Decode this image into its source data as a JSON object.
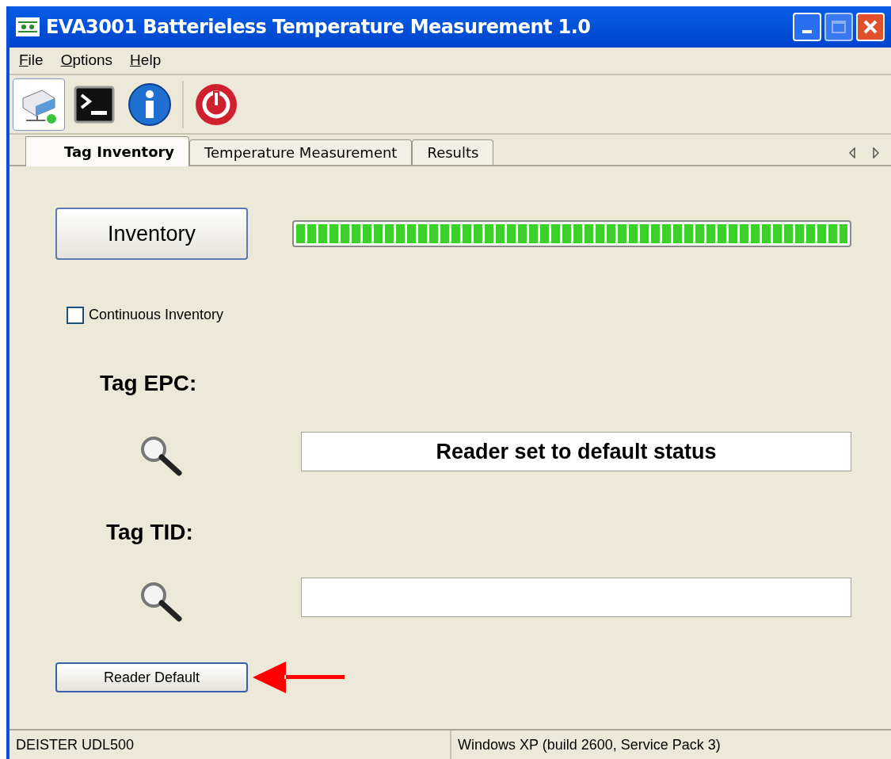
{
  "window": {
    "title": "EVA3001 Batterieless Temperature Measurement 1.0"
  },
  "menu": [
    "File",
    "Options",
    "Help"
  ],
  "toolbar": [
    {
      "kind": "reader",
      "selected": true
    },
    {
      "kind": "console",
      "selected": false
    },
    {
      "kind": "info",
      "selected": false
    },
    {
      "kind": "power",
      "selected": false
    }
  ],
  "tabs": [
    {
      "label": "Tag Inventory",
      "selected": true
    },
    {
      "label": "Temperature Measurement",
      "selected": false
    },
    {
      "label": "Results",
      "selected": false
    }
  ],
  "inventory_button": "Inventory",
  "progress": {
    "level": 1.0
  },
  "continuous_inventory": {
    "label": "Continuous Inventory",
    "checked": false
  },
  "tag_epc": {
    "label": "Tag EPC:",
    "value": "Reader set to default status"
  },
  "tag_tid": {
    "label": "Tag TID:"
  },
  "reader_default_button": "Reader Default",
  "status_bar": [
    "DEISTER UDL500",
    "Windows XP (build 2600, Service Pack 3)"
  ]
}
